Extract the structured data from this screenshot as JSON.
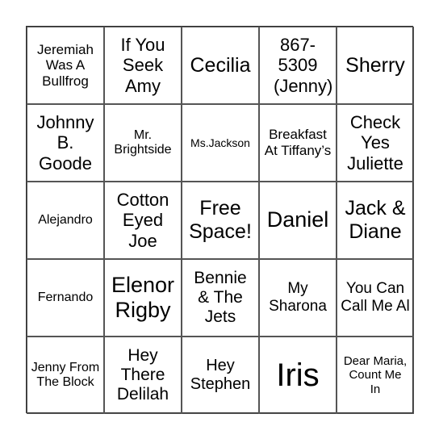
{
  "card": {
    "cells": [
      "Jeremiah Was A Bullfrog",
      "If You Seek Amy",
      "Cecilia",
      "867-5309 (Jenny)",
      "Sherry",
      "Johnny B. Goode",
      "Mr. Brightside",
      "Ms.Jackson",
      "Breakfast At Tiffany’s",
      "Check Yes Juliette",
      "Alejandro",
      "Cotton Eyed Joe",
      "Free Space!",
      "Daniel",
      "Jack & Diane",
      "Fernando",
      "Elenor Rigby",
      "Bennie & The Jets",
      "My Sharona",
      "You Can Call Me Al",
      "Jenny From The Block",
      "Hey There Delilah",
      "Hey Stephen",
      "Iris",
      "Dear Maria, Count Me In"
    ],
    "border_color": "#555555"
  }
}
